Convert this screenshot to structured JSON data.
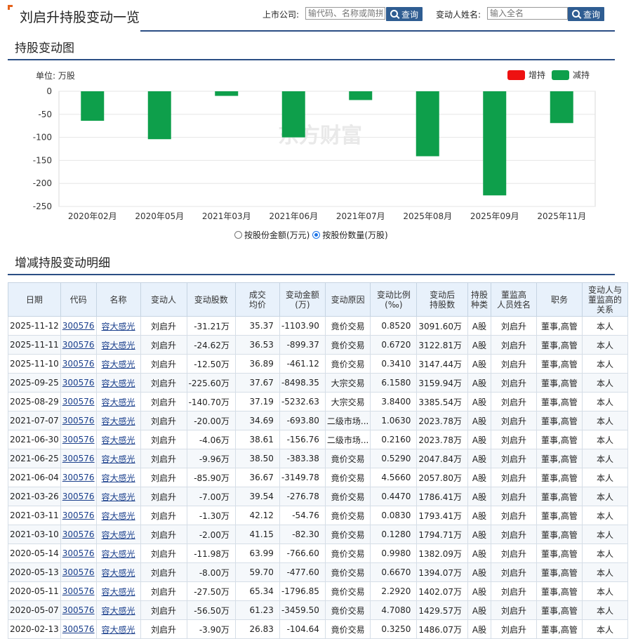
{
  "page": {
    "title": "刘启升持股变动一览"
  },
  "search": {
    "company_label": "上市公司:",
    "company_placeholder": "输代码、名称或简拼",
    "company_button": "查询",
    "person_label": "变动人姓名:",
    "person_placeholder": "输入全名",
    "person_button": "查询"
  },
  "sections": {
    "chart_title": "持股变动图",
    "table_title": "增减持股变动明细"
  },
  "chart_toggle": {
    "options": [
      {
        "label": "按股份金额(万元)",
        "checked": false
      },
      {
        "label": "按股份数量(万股)",
        "checked": true
      }
    ]
  },
  "chart_data": {
    "type": "bar",
    "unit_label": "单位: 万股",
    "categories": [
      "2020年02月",
      "2020年05月",
      "2021年03月",
      "2021年06月",
      "2021年07月",
      "2025年08月",
      "2025年09月",
      "2025年11月"
    ],
    "series": [
      {
        "name": "增持",
        "color": "#ee1111",
        "values": [
          0,
          0,
          0,
          0,
          0,
          0,
          0,
          0
        ]
      },
      {
        "name": "减持",
        "color": "#0e9f4b",
        "values": [
          -64,
          -104,
          -10,
          -100,
          -19,
          -141,
          -226,
          -69
        ]
      }
    ],
    "ylim": [
      -250,
      0
    ],
    "yticks": [
      0,
      -50,
      -100,
      -150,
      -200,
      -250
    ],
    "grid": true,
    "legend": "top-right",
    "watermark": "东方财富"
  },
  "table": {
    "headers": [
      "日期",
      "代码",
      "名称",
      "变动人",
      "变动股数",
      "成交\n均价",
      "变动金额\n(万)",
      "变动原因",
      "变动比例\n(‰)",
      "变动后\n持股数",
      "持股\n种类",
      "董监高\n人员姓名",
      "职务",
      "变动人与\n董监高的\n关系"
    ],
    "rows": [
      [
        "2025-11-12",
        "300576",
        "容大感光",
        "刘启升",
        "-31.21万",
        "35.37",
        "-1103.90",
        "竟价交易",
        "0.8520",
        "3091.60万",
        "A股",
        "刘启升",
        "董事,高管",
        "本人"
      ],
      [
        "2025-11-11",
        "300576",
        "容大感光",
        "刘启升",
        "-24.62万",
        "36.53",
        "-899.37",
        "竟价交易",
        "0.6720",
        "3122.81万",
        "A股",
        "刘启升",
        "董事,高管",
        "本人"
      ],
      [
        "2025-11-10",
        "300576",
        "容大感光",
        "刘启升",
        "-12.50万",
        "36.89",
        "-461.12",
        "竟价交易",
        "0.3410",
        "3147.44万",
        "A股",
        "刘启升",
        "董事,高管",
        "本人"
      ],
      [
        "2025-09-25",
        "300576",
        "容大感光",
        "刘启升",
        "-225.60万",
        "37.67",
        "-8498.35",
        "大宗交易",
        "6.1580",
        "3159.94万",
        "A股",
        "刘启升",
        "董事,高管",
        "本人"
      ],
      [
        "2025-08-29",
        "300576",
        "容大感光",
        "刘启升",
        "-140.70万",
        "37.19",
        "-5232.63",
        "大宗交易",
        "3.8400",
        "3385.54万",
        "A股",
        "刘启升",
        "董事,高管",
        "本人"
      ],
      [
        "2021-07-07",
        "300576",
        "容大感光",
        "刘启升",
        "-20.00万",
        "34.69",
        "-693.80",
        "二级市场...",
        "1.0630",
        "2023.78万",
        "A股",
        "刘启升",
        "董事,高管",
        "本人"
      ],
      [
        "2021-06-30",
        "300576",
        "容大感光",
        "刘启升",
        "-4.06万",
        "38.61",
        "-156.76",
        "二级市场...",
        "0.2160",
        "2023.78万",
        "A股",
        "刘启升",
        "董事,高管",
        "本人"
      ],
      [
        "2021-06-25",
        "300576",
        "容大感光",
        "刘启升",
        "-9.96万",
        "38.50",
        "-383.38",
        "竟价交易",
        "0.5290",
        "2047.84万",
        "A股",
        "刘启升",
        "董事,高管",
        "本人"
      ],
      [
        "2021-06-04",
        "300576",
        "容大感光",
        "刘启升",
        "-85.90万",
        "36.67",
        "-3149.78",
        "竟价交易",
        "4.5660",
        "2057.80万",
        "A股",
        "刘启升",
        "董事,高管",
        "本人"
      ],
      [
        "2021-03-26",
        "300576",
        "容大感光",
        "刘启升",
        "-7.00万",
        "39.54",
        "-276.78",
        "竟价交易",
        "0.4470",
        "1786.41万",
        "A股",
        "刘启升",
        "董事,高管",
        "本人"
      ],
      [
        "2021-03-11",
        "300576",
        "容大感光",
        "刘启升",
        "-1.30万",
        "42.12",
        "-54.76",
        "竟价交易",
        "0.0830",
        "1793.41万",
        "A股",
        "刘启升",
        "董事,高管",
        "本人"
      ],
      [
        "2021-03-10",
        "300576",
        "容大感光",
        "刘启升",
        "-2.00万",
        "41.15",
        "-82.30",
        "竟价交易",
        "0.1280",
        "1794.71万",
        "A股",
        "刘启升",
        "董事,高管",
        "本人"
      ],
      [
        "2020-05-14",
        "300576",
        "容大感光",
        "刘启升",
        "-11.98万",
        "63.99",
        "-766.60",
        "竟价交易",
        "0.9980",
        "1382.09万",
        "A股",
        "刘启升",
        "董事,高管",
        "本人"
      ],
      [
        "2020-05-13",
        "300576",
        "容大感光",
        "刘启升",
        "-8.00万",
        "59.70",
        "-477.60",
        "竟价交易",
        "0.6670",
        "1394.07万",
        "A股",
        "刘启升",
        "董事,高管",
        "本人"
      ],
      [
        "2020-05-11",
        "300576",
        "容大感光",
        "刘启升",
        "-27.50万",
        "65.34",
        "-1796.85",
        "竟价交易",
        "2.2920",
        "1402.07万",
        "A股",
        "刘启升",
        "董事,高管",
        "本人"
      ],
      [
        "2020-05-07",
        "300576",
        "容大感光",
        "刘启升",
        "-56.50万",
        "61.23",
        "-3459.50",
        "竟价交易",
        "4.7080",
        "1429.57万",
        "A股",
        "刘启升",
        "董事,高管",
        "本人"
      ],
      [
        "2020-02-13",
        "300576",
        "容大感光",
        "刘启升",
        "-3.90万",
        "26.83",
        "-104.64",
        "竟价交易",
        "0.3250",
        "1486.07万",
        "A股",
        "刘启升",
        "董事,高管",
        "本人"
      ]
    ]
  }
}
